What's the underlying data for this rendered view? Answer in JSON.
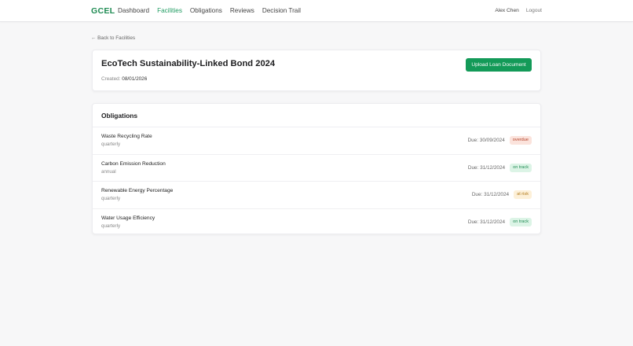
{
  "brand": "GCEL",
  "nav": [
    "Dashboard",
    "Facilities",
    "Obligations",
    "Reviews",
    "Decision Trail"
  ],
  "nav_active": "Facilities",
  "user": {
    "name": "Alex Chen",
    "logout": "Logout"
  },
  "back_link": "← Back to Facilities",
  "facility": {
    "title": "EcoTech Sustainability-Linked Bond 2024",
    "created_label": "Created:",
    "created_value": "08/01/2026",
    "upload_button": "Upload Loan Document"
  },
  "obligations": {
    "heading": "Obligations",
    "items": [
      {
        "name": "Waste Recycling Rate",
        "frequency": "quarterly",
        "due": "Due: 30/09/2024",
        "status": "overdue",
        "status_kind": "overdue"
      },
      {
        "name": "Carbon Emission Reduction",
        "frequency": "annual",
        "due": "Due: 31/12/2024",
        "status": "on track",
        "status_kind": "ontrack"
      },
      {
        "name": "Renewable Energy Percentage",
        "frequency": "quarterly",
        "due": "Due: 31/12/2024",
        "status": "at risk",
        "status_kind": "atrisk"
      },
      {
        "name": "Water Usage Efficiency",
        "frequency": "quarterly",
        "due": "Due: 31/12/2024",
        "status": "on track",
        "status_kind": "ontrack"
      }
    ]
  },
  "colors": {
    "brand": "#1f8b53",
    "primary_button": "#139a58",
    "overdue_bg": "#fbe3dc",
    "ontrack_bg": "#dcf4e6",
    "atrisk_bg": "#fdf0d8"
  }
}
